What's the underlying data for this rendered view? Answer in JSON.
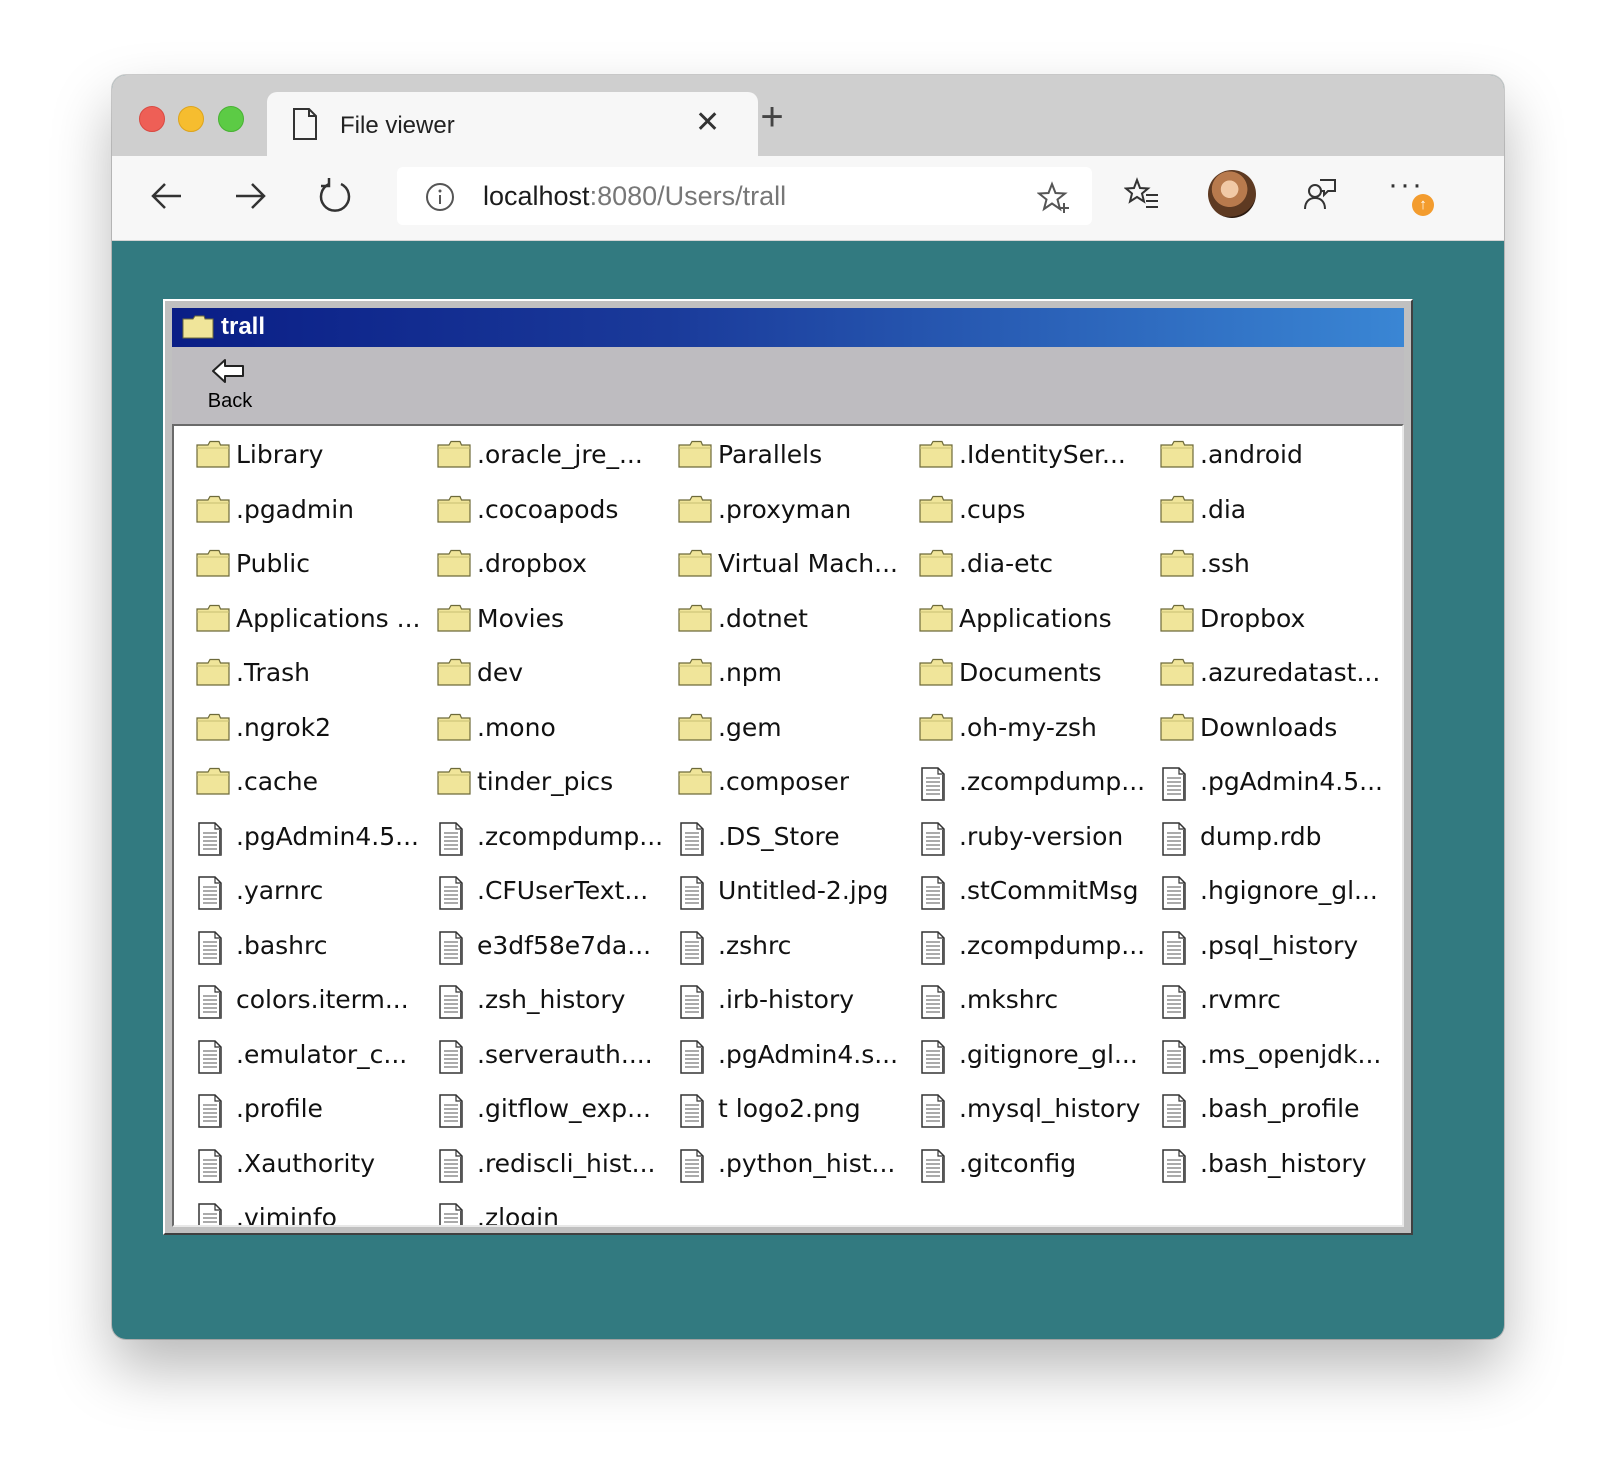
{
  "browser": {
    "tab_title": "File viewer",
    "url_host": "localhost",
    "url_rest": ":8080/Users/trall",
    "more_label": "···"
  },
  "window": {
    "title": "trall",
    "back_label": "Back"
  },
  "colors": {
    "desktop": "#327a80",
    "titlebar_start": "#0a1e86",
    "titlebar_end": "#3a86d4",
    "folder": "#f0e59a"
  },
  "files": [
    {
      "name": "Library",
      "type": "folder"
    },
    {
      "name": ".oracle_jre_...",
      "type": "folder"
    },
    {
      "name": "Parallels",
      "type": "folder"
    },
    {
      "name": ".IdentitySer...",
      "type": "folder"
    },
    {
      "name": ".android",
      "type": "folder"
    },
    {
      "name": ".pgadmin",
      "type": "folder"
    },
    {
      "name": ".cocoapods",
      "type": "folder"
    },
    {
      "name": ".proxyman",
      "type": "folder"
    },
    {
      "name": ".cups",
      "type": "folder"
    },
    {
      "name": ".dia",
      "type": "folder"
    },
    {
      "name": "Public",
      "type": "folder"
    },
    {
      "name": ".dropbox",
      "type": "folder"
    },
    {
      "name": "Virtual Mach...",
      "type": "folder"
    },
    {
      "name": ".dia-etc",
      "type": "folder"
    },
    {
      "name": ".ssh",
      "type": "folder"
    },
    {
      "name": "Applications ...",
      "type": "folder"
    },
    {
      "name": "Movies",
      "type": "folder"
    },
    {
      "name": ".dotnet",
      "type": "folder"
    },
    {
      "name": "Applications",
      "type": "folder"
    },
    {
      "name": "Dropbox",
      "type": "folder"
    },
    {
      "name": ".Trash",
      "type": "folder"
    },
    {
      "name": "dev",
      "type": "folder"
    },
    {
      "name": ".npm",
      "type": "folder"
    },
    {
      "name": "Documents",
      "type": "folder"
    },
    {
      "name": ".azuredatast...",
      "type": "folder"
    },
    {
      "name": ".ngrok2",
      "type": "folder"
    },
    {
      "name": ".mono",
      "type": "folder"
    },
    {
      "name": ".gem",
      "type": "folder"
    },
    {
      "name": ".oh-my-zsh",
      "type": "folder"
    },
    {
      "name": "Downloads",
      "type": "folder"
    },
    {
      "name": ".cache",
      "type": "folder"
    },
    {
      "name": "tinder_pics",
      "type": "folder"
    },
    {
      "name": ".composer",
      "type": "folder"
    },
    {
      "name": ".zcompdump...",
      "type": "file"
    },
    {
      "name": ".pgAdmin4.5...",
      "type": "file"
    },
    {
      "name": ".pgAdmin4.5...",
      "type": "file"
    },
    {
      "name": ".zcompdump...",
      "type": "file"
    },
    {
      "name": ".DS_Store",
      "type": "file"
    },
    {
      "name": ".ruby-version",
      "type": "file"
    },
    {
      "name": "dump.rdb",
      "type": "file"
    },
    {
      "name": ".yarnrc",
      "type": "file"
    },
    {
      "name": ".CFUserText...",
      "type": "file"
    },
    {
      "name": "Untitled-2.jpg",
      "type": "file"
    },
    {
      "name": ".stCommitMsg",
      "type": "file"
    },
    {
      "name": ".hgignore_gl...",
      "type": "file"
    },
    {
      "name": ".bashrc",
      "type": "file"
    },
    {
      "name": "e3df58e7da...",
      "type": "file"
    },
    {
      "name": ".zshrc",
      "type": "file"
    },
    {
      "name": ".zcompdump...",
      "type": "file"
    },
    {
      "name": ".psql_history",
      "type": "file"
    },
    {
      "name": "colors.iterm...",
      "type": "file"
    },
    {
      "name": ".zsh_history",
      "type": "file"
    },
    {
      "name": ".irb-history",
      "type": "file"
    },
    {
      "name": ".mkshrc",
      "type": "file"
    },
    {
      "name": ".rvmrc",
      "type": "file"
    },
    {
      "name": ".emulator_c...",
      "type": "file"
    },
    {
      "name": ".serverauth....",
      "type": "file"
    },
    {
      "name": ".pgAdmin4.s...",
      "type": "file"
    },
    {
      "name": ".gitignore_gl...",
      "type": "file"
    },
    {
      "name": ".ms_openjdk...",
      "type": "file"
    },
    {
      "name": ".profile",
      "type": "file"
    },
    {
      "name": ".gitflow_exp...",
      "type": "file"
    },
    {
      "name": "t logo2.png",
      "type": "file"
    },
    {
      "name": ".mysql_history",
      "type": "file"
    },
    {
      "name": ".bash_profile",
      "type": "file"
    },
    {
      "name": ".Xauthority",
      "type": "file"
    },
    {
      "name": ".rediscli_hist...",
      "type": "file"
    },
    {
      "name": ".python_hist...",
      "type": "file"
    },
    {
      "name": ".gitconfig",
      "type": "file"
    },
    {
      "name": ".bash_history",
      "type": "file"
    },
    {
      "name": ".viminfo",
      "type": "file"
    },
    {
      "name": ".zlogin",
      "type": "file"
    }
  ]
}
